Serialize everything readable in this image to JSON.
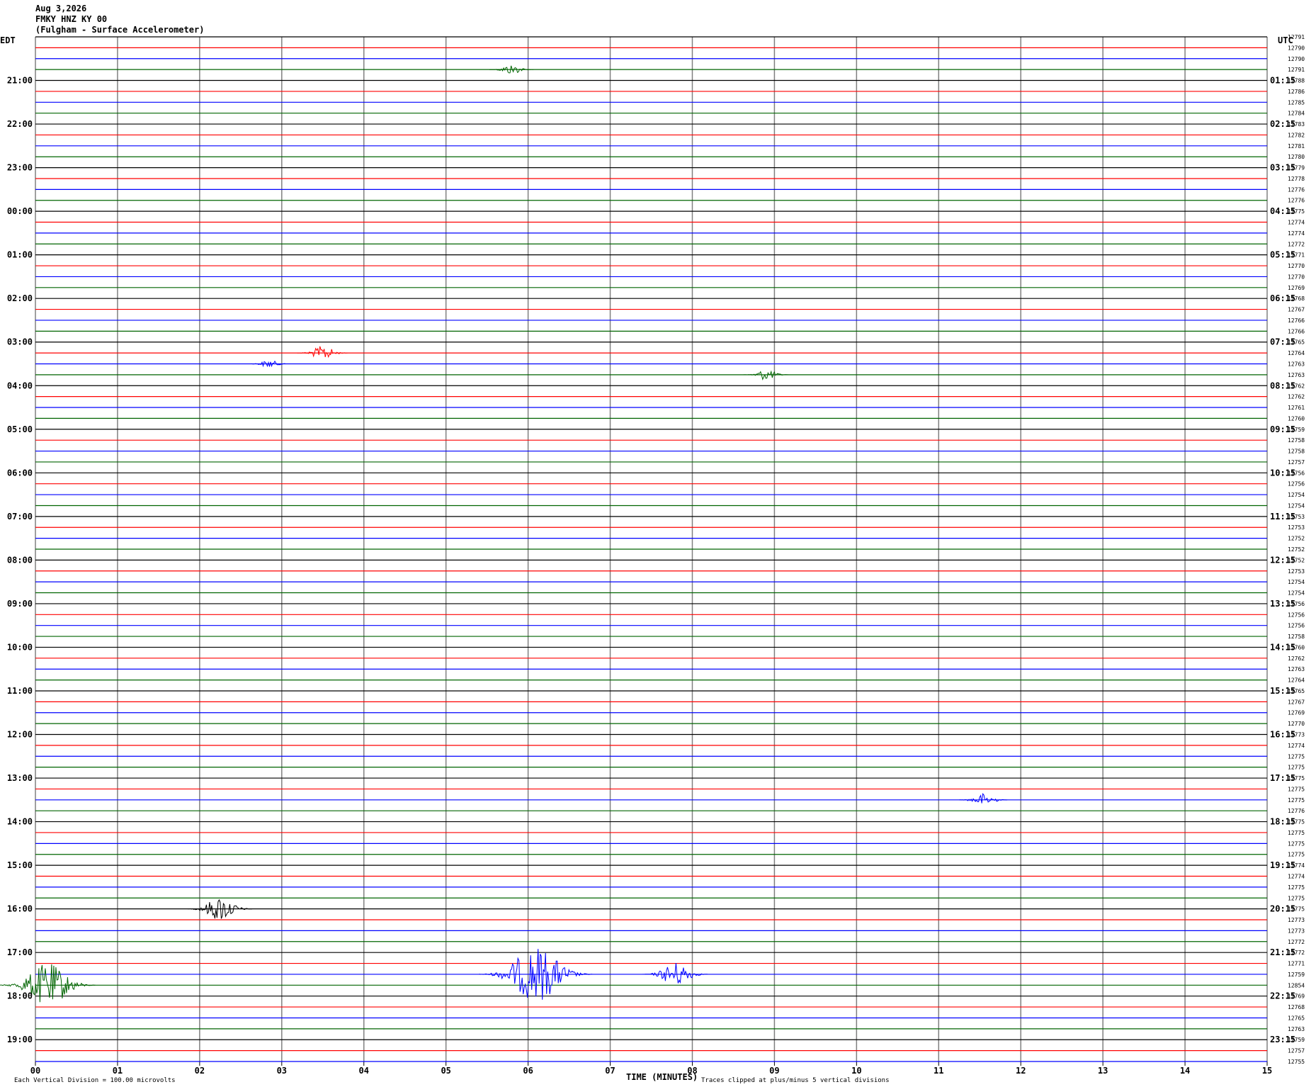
{
  "header": {
    "date": "Aug 3,2026",
    "station": "FMKY HNZ KY 00",
    "location": "(Fulgham - Surface Accelerometer)"
  },
  "left_timezone": "EDT",
  "right_timezone": "UTC",
  "footer": {
    "xlabel": "TIME (MINUTES)",
    "scale_note": "Each Vertical Division =  100.00 microvolts",
    "clip_note": "Traces clipped at plus/minus 5 vertical divisions"
  },
  "colors": {
    "trace_cycle": [
      "#000000",
      "#ff0000",
      "#0000ff",
      "#006400"
    ],
    "grid": "#808080"
  },
  "chart_data": {
    "type": "line",
    "title": "FMKY HNZ KY 00",
    "xlabel": "TIME (MINUTES)",
    "xlim": [
      0,
      15
    ],
    "x_ticks": [
      "00",
      "01",
      "02",
      "03",
      "04",
      "05",
      "06",
      "07",
      "08",
      "09",
      "10",
      "11",
      "12",
      "13",
      "14",
      "15"
    ],
    "rows_per_hour": 4,
    "left_hour_labels": [
      "21:00",
      "22:00",
      "23:00",
      "00:00",
      "01:00",
      "02:00",
      "03:00",
      "04:00",
      "05:00",
      "06:00",
      "07:00",
      "08:00",
      "09:00",
      "10:00",
      "11:00",
      "12:00",
      "13:00",
      "14:00",
      "15:00",
      "16:00",
      "17:00",
      "18:00",
      "19:00"
    ],
    "right_hour_labels": [
      "01:15",
      "02:15",
      "03:15",
      "04:15",
      "05:15",
      "06:15",
      "07:15",
      "08:15",
      "09:15",
      "10:15",
      "11:15",
      "12:15",
      "13:15",
      "14:15",
      "15:15",
      "16:15",
      "17:15",
      "18:15",
      "19:15",
      "20:15",
      "21:15",
      "22:15",
      "23:15"
    ],
    "trace_offsets": [
      "12791",
      "12790",
      "12790",
      "12791",
      "12788",
      "12786",
      "12785",
      "12784",
      "12783",
      "12782",
      "12781",
      "12780",
      "12779",
      "12778",
      "12776",
      "12776",
      "12775",
      "12774",
      "12774",
      "12772",
      "12771",
      "12770",
      "12770",
      "12769",
      "12768",
      "12767",
      "12766",
      "12766",
      "12765",
      "12764",
      "12763",
      "12763",
      "12762",
      "12762",
      "12761",
      "12760",
      "12759",
      "12758",
      "12758",
      "12757",
      "12756",
      "12756",
      "12754",
      "12754",
      "12753",
      "12753",
      "12752",
      "12752",
      "12752",
      "12753",
      "12754",
      "12754",
      "12756",
      "12756",
      "12756",
      "12758",
      "12760",
      "12762",
      "12763",
      "12764",
      "12765",
      "12767",
      "12769",
      "12770",
      "12773",
      "12774",
      "12775",
      "12775",
      "12775",
      "12775",
      "12775",
      "12776",
      "12775",
      "12775",
      "12775",
      "12775",
      "12774",
      "12774",
      "12775",
      "12775",
      "12775",
      "12773",
      "12773",
      "12772",
      "12772",
      "12771",
      "12759",
      "12854",
      "12769",
      "12768",
      "12765",
      "12763",
      "12759",
      "12757",
      "12755"
    ],
    "events": [
      {
        "row": 3,
        "minute": 5.8,
        "amp": 0.9
      },
      {
        "row": 29,
        "minute": 3.5,
        "amp": 1.3
      },
      {
        "row": 30,
        "minute": 2.85,
        "amp": 0.7
      },
      {
        "row": 31,
        "minute": 8.9,
        "amp": 1.0
      },
      {
        "row": 70,
        "minute": 11.55,
        "amp": 1.2
      },
      {
        "row": 80,
        "minute": 2.25,
        "amp": 2.2
      },
      {
        "row": 86,
        "minute": 6.1,
        "amp": 5.0
      },
      {
        "row": 86,
        "minute": 7.8,
        "amp": 2.2
      },
      {
        "row": 87,
        "minute": 0.15,
        "amp": 4.0
      }
    ]
  }
}
